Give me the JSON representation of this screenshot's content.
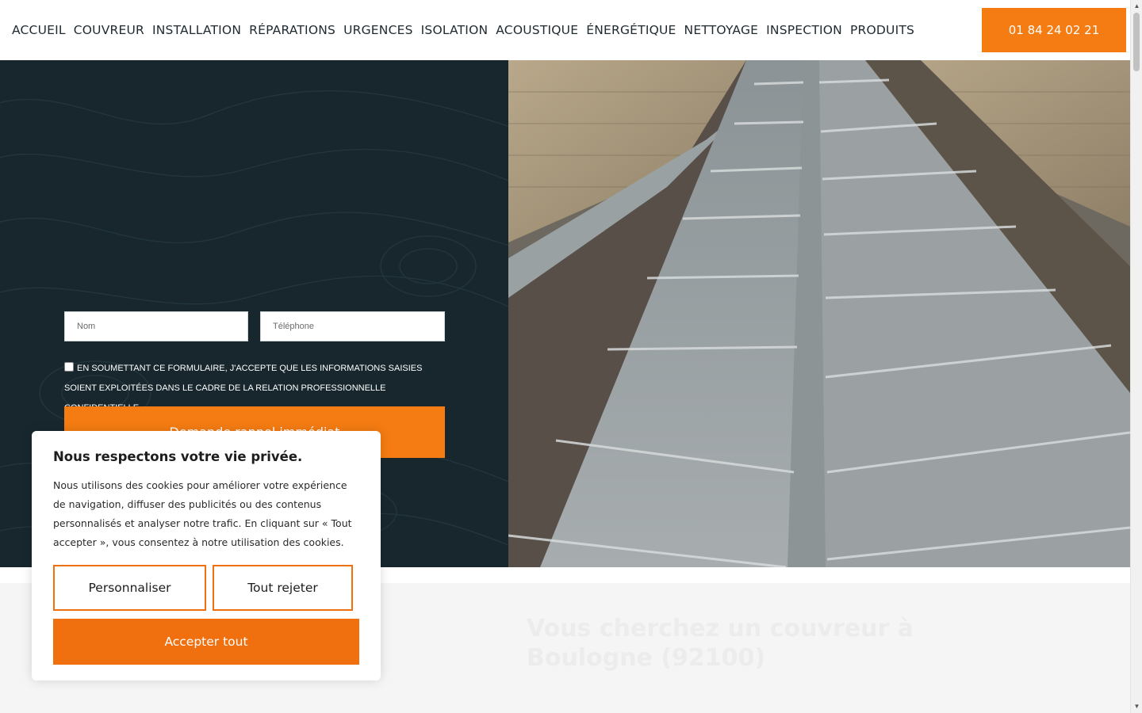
{
  "nav": {
    "items": [
      {
        "label": "ACCUEIL"
      },
      {
        "label": "COUVREUR"
      },
      {
        "label": "INSTALLATION"
      },
      {
        "label": "RÉPARATIONS"
      },
      {
        "label": "URGENCES"
      },
      {
        "label": "ISOLATION"
      },
      {
        "label": "ACOUSTIQUE"
      },
      {
        "label": "ÉNERGÉTIQUE"
      },
      {
        "label": "NETTOYAGE"
      },
      {
        "label": "INSPECTION"
      },
      {
        "label": "PRODUITS"
      }
    ],
    "phone_label": "01 84 24 02 21"
  },
  "form": {
    "name_placeholder": "Nom",
    "phone_placeholder": "Téléphone",
    "consent_text": "En soumettant ce formulaire, j'accepte que les informations saisies soient exploitées dans le cadre de la relation professionnelle confidentielle.",
    "submit_label": "Demande rappel immédiat"
  },
  "lower": {
    "title": "Vous cherchez un couvreur à Boulogne (92100)"
  },
  "cookie": {
    "title": "Nous respectons votre vie privée.",
    "text": "Nous utilisons des cookies pour améliorer votre expérience de navigation, diffuser des publicités ou des contenus personnalisés et analyser notre trafic. En cliquant sur « Tout accepter », vous consentez à notre utilisation des cookies.",
    "customize_label": "Personnaliser",
    "reject_label": "Tout rejeter",
    "accept_label": "Accepter tout"
  },
  "colors": {
    "accent": "#f57c12",
    "hero_dark": "#18272e"
  },
  "icons": {
    "scroll_up": "scroll-up-arrow-icon",
    "scroll_down": "scroll-down-arrow-icon"
  }
}
